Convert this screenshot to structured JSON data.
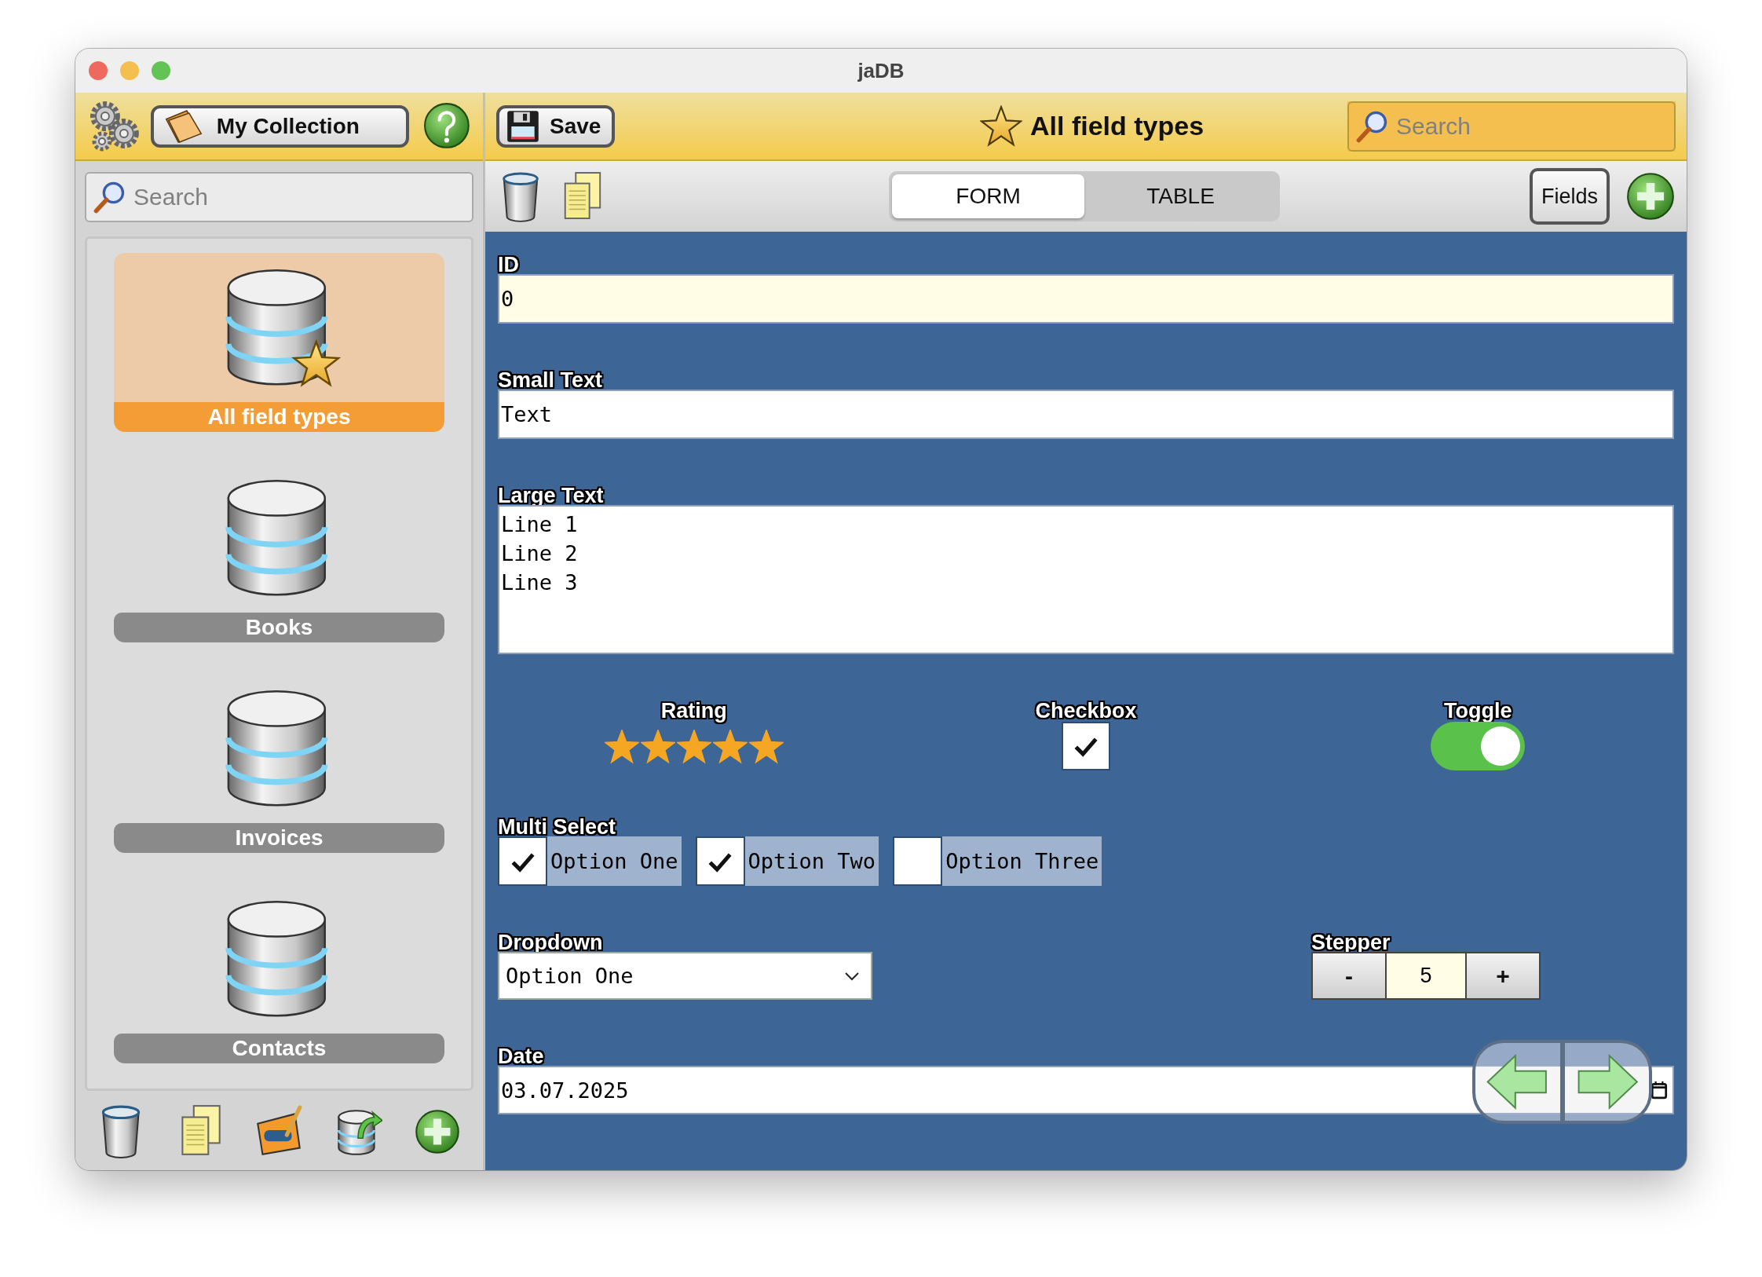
{
  "window": {
    "title": "jaDB"
  },
  "sidebar": {
    "collection_button": "My Collection",
    "search": {
      "placeholder": "Search"
    },
    "items": [
      {
        "label": "All field types",
        "selected": true,
        "starred": true
      },
      {
        "label": "Books",
        "selected": false,
        "starred": false
      },
      {
        "label": "Invoices",
        "selected": false,
        "starred": false
      },
      {
        "label": "Contacts",
        "selected": false,
        "starred": false
      }
    ]
  },
  "toolbar": {
    "save_button": "Save",
    "title": "All field types",
    "search": {
      "placeholder": "Search"
    }
  },
  "view_tabs": [
    {
      "label": "FORM",
      "selected": true
    },
    {
      "label": "TABLE",
      "selected": false
    }
  ],
  "fields_button": "Fields",
  "form": {
    "rows": [
      {
        "fields": [
          {
            "kind": "text",
            "label": "ID",
            "value": "0",
            "read_only": true
          }
        ]
      },
      {
        "fields": [
          {
            "kind": "text",
            "label": "Small Text",
            "value": "Text",
            "read_only": false
          }
        ]
      },
      {
        "fields": [
          {
            "kind": "textarea",
            "label": "Large Text",
            "lines": [
              "Line 1",
              "Line 2",
              "Line 3"
            ]
          }
        ]
      },
      {
        "fields": [
          {
            "kind": "rating",
            "label": "Rating",
            "stars": 5
          },
          {
            "kind": "checkbox",
            "label": "Checkbox",
            "checked": true
          },
          {
            "kind": "toggle",
            "label": "Toggle",
            "on": true
          }
        ]
      },
      {
        "fields": [
          {
            "kind": "multiselect",
            "label": "Multi Select",
            "options": [
              {
                "label": "Option One",
                "checked": true
              },
              {
                "label": "Option Two",
                "checked": true
              },
              {
                "label": "Option Three",
                "checked": false
              }
            ]
          }
        ]
      },
      {
        "fields": [
          {
            "kind": "dropdown",
            "label": "Dropdown",
            "value": "Option One"
          },
          {
            "kind": "stepper",
            "label": "Stepper",
            "decrement": "-",
            "value": "5",
            "increment": "+"
          }
        ]
      },
      {
        "fields": [
          {
            "kind": "date",
            "label": "Date",
            "value": "03.07.2025"
          }
        ]
      }
    ]
  }
}
